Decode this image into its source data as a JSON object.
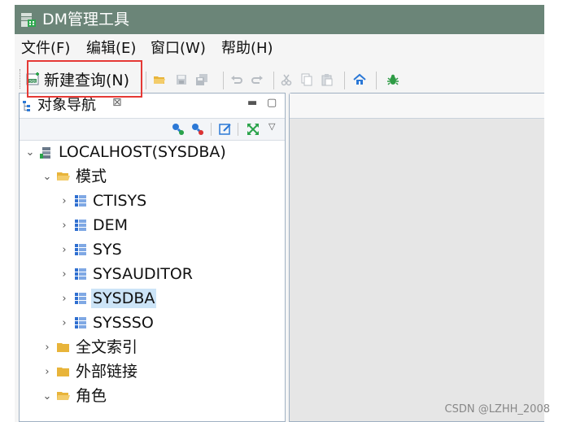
{
  "window": {
    "title": "DM管理工具"
  },
  "menu": {
    "items": [
      "文件(F)",
      "编辑(E)",
      "窗口(W)",
      "帮助(H)"
    ]
  },
  "toolbar": {
    "new_query_label": "新建查询(N)"
  },
  "navigator": {
    "tab_title": "对象导航",
    "tab_close": "⊠",
    "tree": [
      {
        "label": "LOCALHOST(SYSDBA)",
        "level": 0,
        "expanded": true,
        "icon": "server-icon"
      },
      {
        "label": "模式",
        "level": 1,
        "expanded": true,
        "icon": "folder-open-icon"
      },
      {
        "label": "CTISYS",
        "level": 2,
        "expanded": false,
        "icon": "schema-icon"
      },
      {
        "label": "DEM",
        "level": 2,
        "expanded": false,
        "icon": "schema-icon"
      },
      {
        "label": "SYS",
        "level": 2,
        "expanded": false,
        "icon": "schema-icon"
      },
      {
        "label": "SYSAUDITOR",
        "level": 2,
        "expanded": false,
        "icon": "schema-icon"
      },
      {
        "label": "SYSDBA",
        "level": 2,
        "expanded": false,
        "icon": "schema-icon",
        "selected": true
      },
      {
        "label": "SYSSSO",
        "level": 2,
        "expanded": false,
        "icon": "schema-icon"
      },
      {
        "label": "全文索引",
        "level": 1,
        "expanded": false,
        "icon": "folder-icon"
      },
      {
        "label": "外部链接",
        "level": 1,
        "expanded": false,
        "icon": "folder-icon"
      },
      {
        "label": "角色",
        "level": 1,
        "expanded": true,
        "icon": "folder-open-icon"
      }
    ]
  },
  "watermark": "CSDN @LZHH_2008",
  "colors": {
    "titlebar": "#6b8578",
    "selection": "#cce4f7",
    "highlight_box": "#e53935",
    "folder": "#e8b43a",
    "schema": "#2f6fd0"
  }
}
